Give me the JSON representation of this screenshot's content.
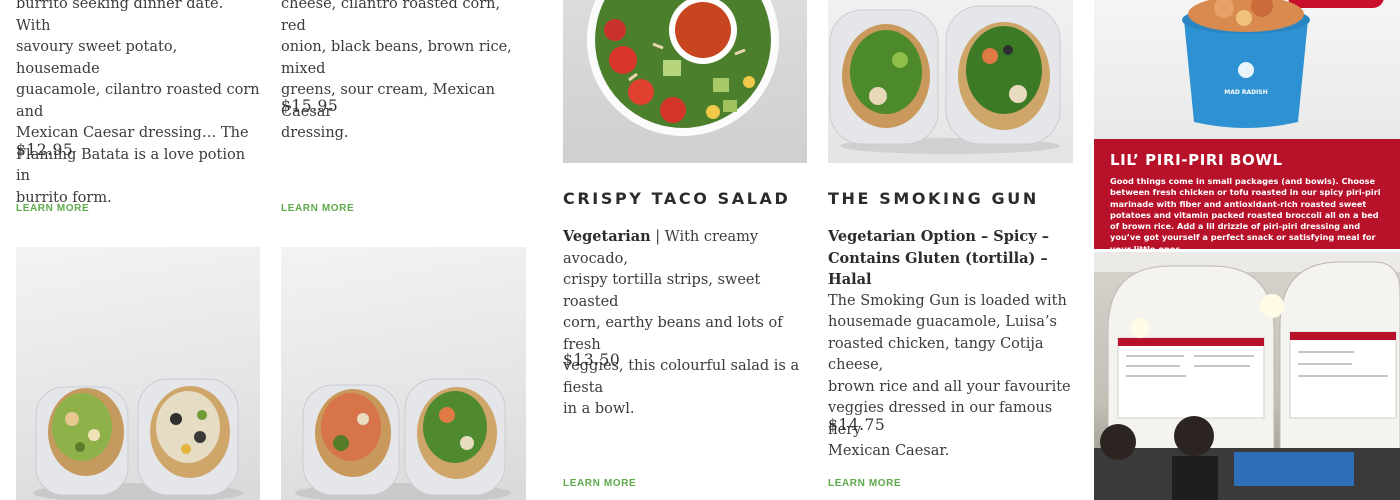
{
  "items": {
    "flaming_batata": {
      "desc_lines": [
        "burrito seeking dinner date. With",
        "savoury sweet potato, housemade",
        "guacamole, cilantro roasted corn and",
        "Mexican Caesar dressing… The",
        "Flaming Batata is a love potion in",
        "burrito form."
      ],
      "price": "$12.95",
      "learn_more": "LEARN MORE"
    },
    "second_burrito": {
      "desc_lines": [
        "cheese, cilantro roasted corn, red",
        "onion, black beans, brown rice, mixed",
        "greens, sour cream, Mexican Caesar",
        "dressing."
      ],
      "price": "$15.95",
      "learn_more": "LEARN MORE"
    },
    "crispy_taco_salad": {
      "title": "CRISPY TACO SALAD",
      "tag": "Vegetarian",
      "desc_first": " | With creamy avocado,",
      "desc_lines": [
        "crispy tortilla strips, sweet roasted",
        "corn, earthy beans and lots of fresh",
        "veggies, this colourful salad is a fiesta",
        "in a bowl."
      ],
      "price": "$13.50",
      "learn_more": "LEARN MORE"
    },
    "smoking_gun": {
      "title": "THE SMOKING GUN",
      "tags": [
        "Vegetarian Option – Spicy –",
        "Contains Gluten (tortilla) – Halal"
      ],
      "desc_lines": [
        "The Smoking Gun is loaded with",
        "housemade guacamole, Luisa’s",
        "roasted chicken, tangy Cotija cheese,",
        "brown rice and all your favourite",
        "veggies dressed in our famous fiery",
        "Mexican Caesar."
      ],
      "price": "$14.75",
      "learn_more": "LEARN MORE"
    }
  },
  "promo": {
    "title": "LIL’ PIRI-PIRI BOWL",
    "description": "Good things come in small packages (and bowls). Choose between fresh chicken or tofu roasted in our spicy piri-piri marinade with fiber and antioxidant-rich roasted sweet potatoes and vitamin packed roasted broccoli all on a bed of brown rice. Add a lil drizzle of piri-piri dressing and you’ve got yourself a perfect snack or satisfying meal for your little ones.",
    "cup_brand": "MAD RADISH"
  },
  "colors": {
    "accent_green": "#5daa4a",
    "promo_red": "#b8112a",
    "cup_blue": "#2e92d2"
  }
}
